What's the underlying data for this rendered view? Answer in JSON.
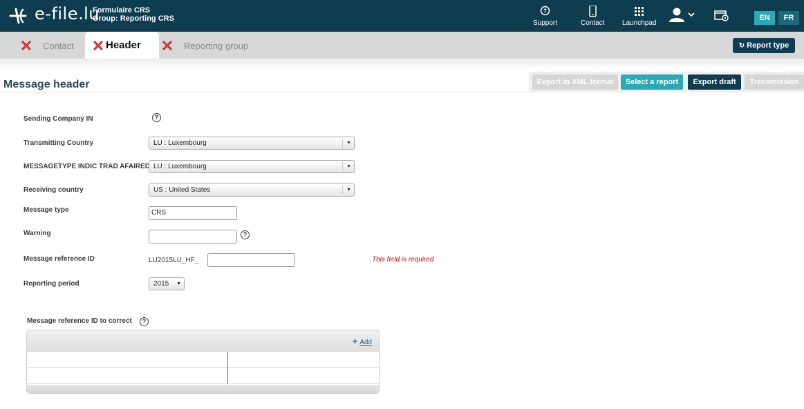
{
  "header": {
    "brand": "e-file.lu",
    "form_title": "Formulaire CRS",
    "group": "Group: Reporting CRS",
    "nav": [
      {
        "label": "Support",
        "icon": "help-circle-icon"
      },
      {
        "label": "Contact",
        "icon": "phone-icon"
      },
      {
        "label": "Launchpad",
        "icon": "grid-icon"
      }
    ],
    "user_icon": "user-icon",
    "settings_icon": "window-settings-icon",
    "languages": [
      "EN",
      "FR"
    ],
    "active_language": "EN"
  },
  "tabs": [
    {
      "label": "Contact",
      "status_icon": "error-x-icon",
      "active": false
    },
    {
      "label": "Header",
      "status_icon": "error-x-icon",
      "active": true
    },
    {
      "label": "Reporting group",
      "status_icon": "error-x-icon",
      "active": false
    }
  ],
  "report_type_button": "Report type",
  "page_title": "Message header",
  "toolbar": {
    "export_xml": "Export in XML format",
    "select_report": "Select a report",
    "export_draft": "Export draft",
    "transmission": "Transmission"
  },
  "form": {
    "sending_company": {
      "label": "Sending Company IN"
    },
    "transmitting_country": {
      "label": "Transmitting Country",
      "value": "LU : Luxembourg"
    },
    "messagetype_indic": {
      "label": "MESSAGETYPE INDIC TRAD AFAIRED",
      "value": "LU : Luxembourg"
    },
    "receiving_country": {
      "label": "Receiving country",
      "value": "US : United States"
    },
    "message_type": {
      "label": "Message type",
      "value": "CRS"
    },
    "warning": {
      "label": "Warning",
      "value": ""
    },
    "message_reference_id": {
      "label": "Message reference ID",
      "prefix": "LU2015LU_HF_",
      "value": "",
      "error": "This field is required"
    },
    "reporting_period": {
      "label": "Reporting period",
      "value": "2015"
    }
  },
  "correction": {
    "label": "Message reference ID to correct",
    "add_label": "Add",
    "rows": [
      [
        "",
        ""
      ],
      [
        "",
        ""
      ]
    ]
  },
  "colors": {
    "topbar": "#0e3d4f",
    "accent": "#2ca9b7",
    "error": "#d40000"
  }
}
